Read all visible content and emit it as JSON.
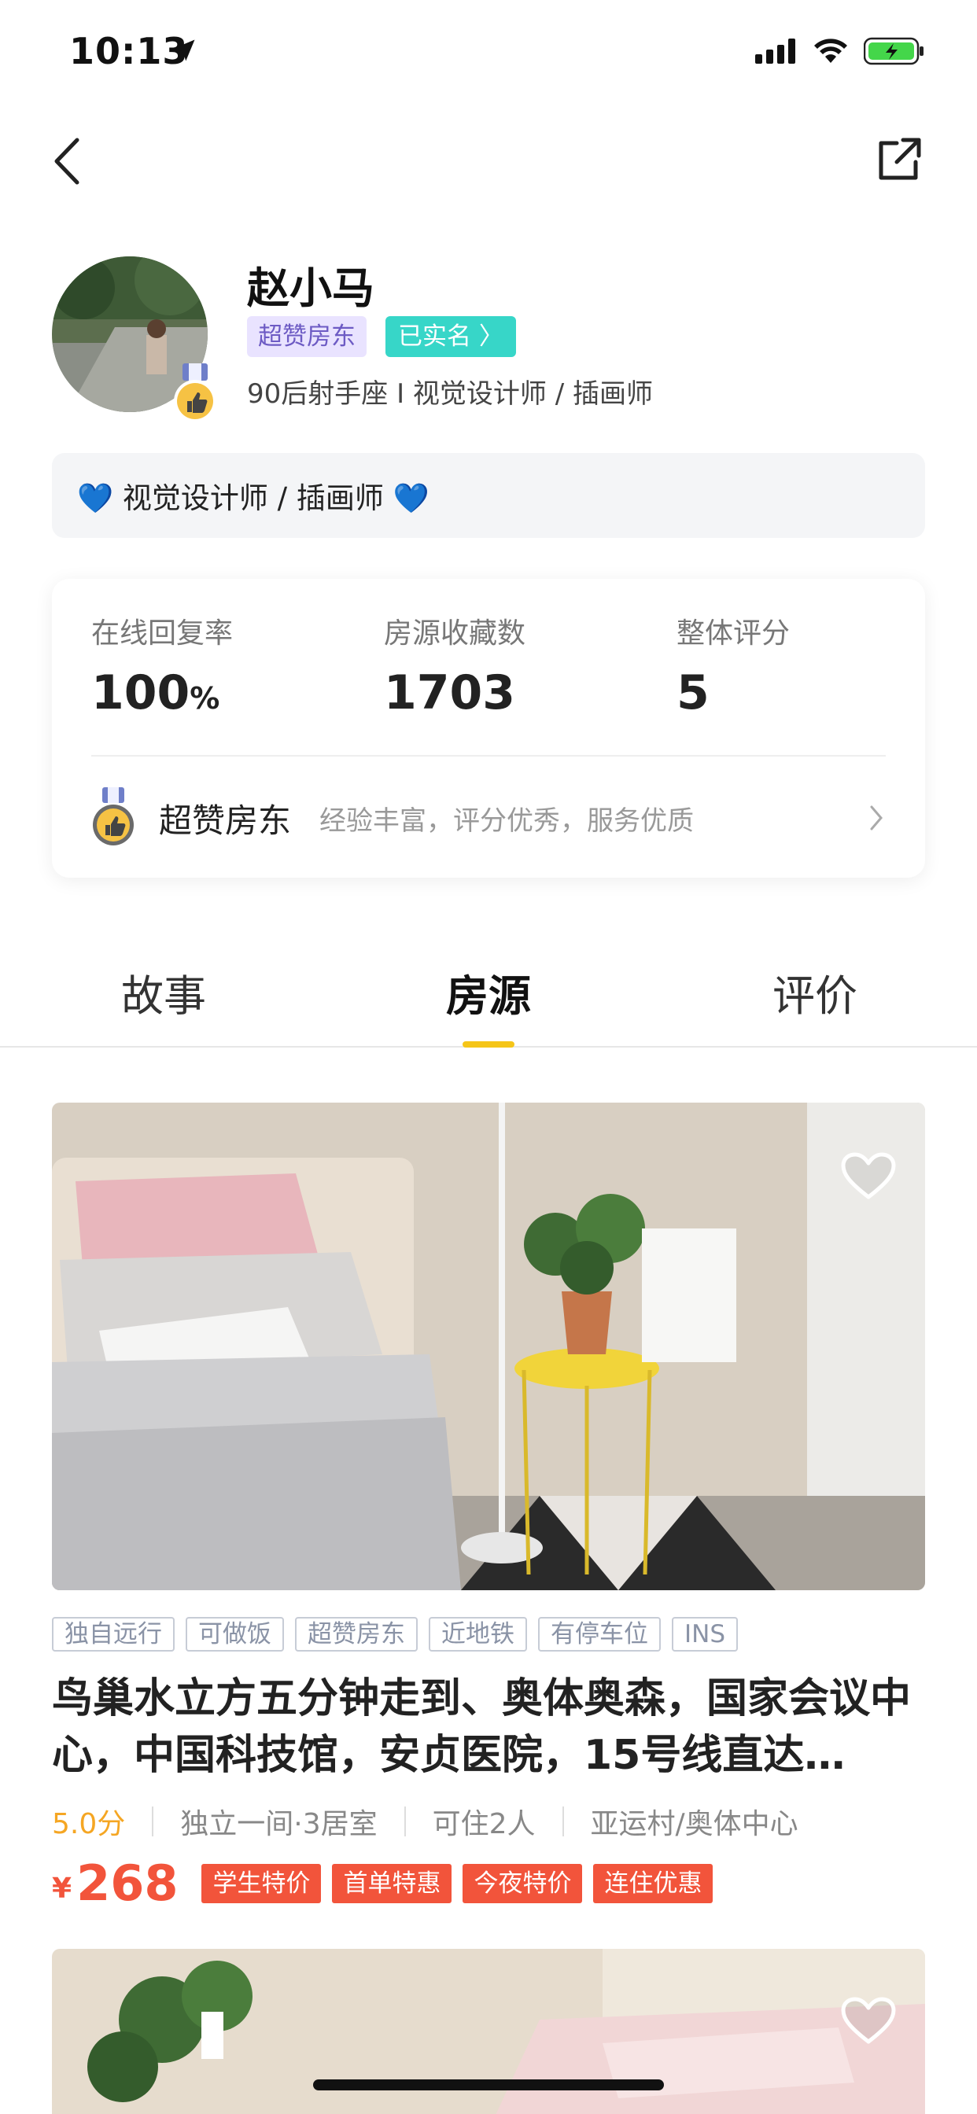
{
  "status_bar": {
    "time": "10:13"
  },
  "profile": {
    "name": "赵小马",
    "badge_super": "超赞房东",
    "badge_verified": "已实名 〉",
    "description": "90后射手座 I 视觉设计师 / 插画师",
    "intro": "💙 视觉设计师 / 插画师 💙"
  },
  "stats": [
    {
      "label": "在线回复率",
      "value": "100",
      "unit": "%"
    },
    {
      "label": "房源收藏数",
      "value": "1703",
      "unit": ""
    },
    {
      "label": "整体评分",
      "value": "5",
      "unit": ""
    }
  ],
  "host": {
    "title": "超赞房东",
    "description": "经验丰富，评分优秀，服务优质"
  },
  "tabs": [
    "故事",
    "房源",
    "评价"
  ],
  "listing": {
    "features": [
      "独自远行",
      "可做饭",
      "超赞房东",
      "近地铁",
      "有停车位",
      "INS"
    ],
    "title": "鸟巢水立方五分钟走到、奥体奥森，国家会议中心，中国科技馆，安贞医院，15号线直达…",
    "rating": "5.0分",
    "room_type": "独立一间·3居室",
    "capacity": "可住2人",
    "location": "亚运村/奥体中心",
    "currency": "¥",
    "price": "268",
    "promos": [
      "学生特价",
      "首单特惠",
      "今夜特价",
      "连住优惠"
    ]
  },
  "colors": {
    "accent": "#f5c518",
    "price": "#f2543b",
    "verified": "#37d6c8",
    "rating": "#f5a623"
  }
}
